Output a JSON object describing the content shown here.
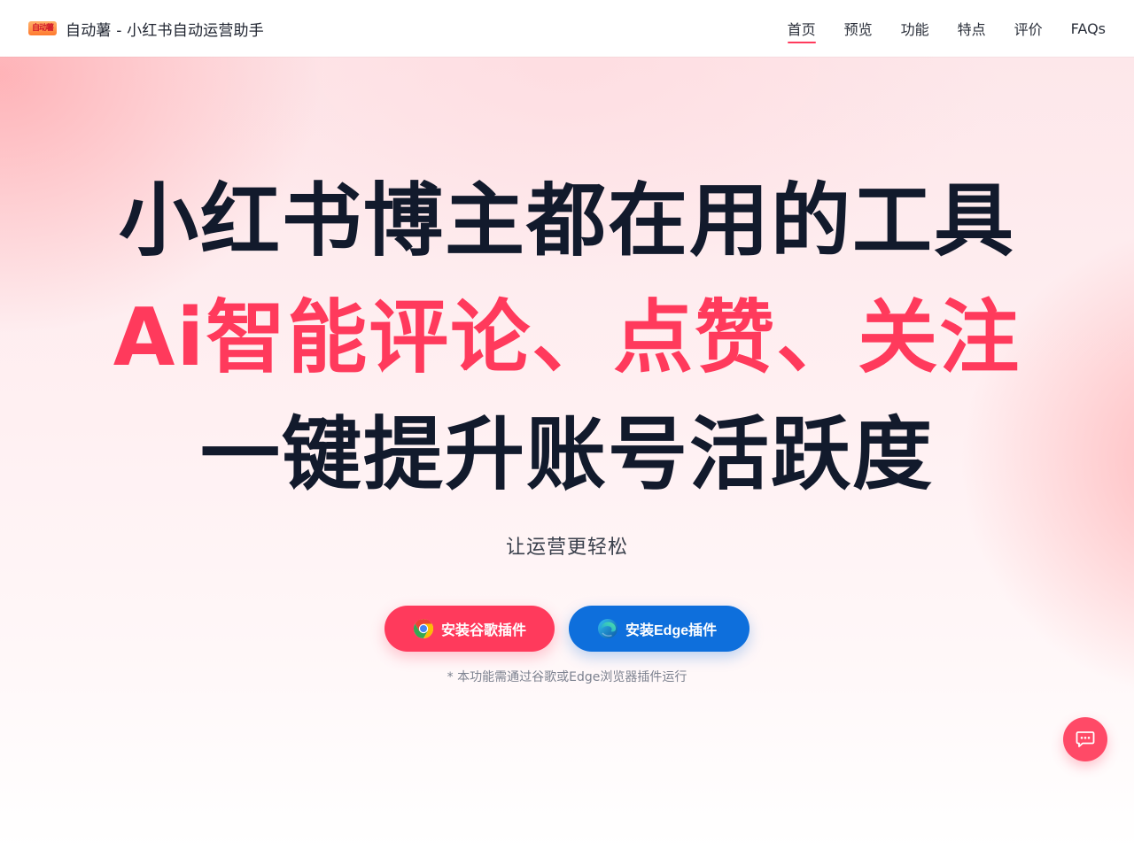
{
  "header": {
    "logo_text": "自动薯",
    "title": "自动薯 - 小红书自动运营助手",
    "nav": [
      {
        "label": "首页",
        "active": true
      },
      {
        "label": "预览",
        "active": false
      },
      {
        "label": "功能",
        "active": false
      },
      {
        "label": "特点",
        "active": false
      },
      {
        "label": "评价",
        "active": false
      },
      {
        "label": "FAQs",
        "active": false
      }
    ]
  },
  "hero": {
    "line1": "小红书博主都在用的工具",
    "line2": "Ai智能评论、点赞、关注",
    "line3": "一键提升账号活跃度",
    "subtitle": "让运营更轻松",
    "buttons": {
      "chrome_label": "安装谷歌插件",
      "edge_label": "安装Edge插件"
    },
    "note": "* 本功能需通过谷歌或Edge浏览器插件运行"
  },
  "icons": {
    "chrome": "chrome-icon",
    "edge": "edge-icon",
    "chat": "chat-bubble-icon"
  },
  "colors": {
    "accent_red": "#ff3a5c",
    "edge_blue": "#0e6fdc",
    "headline_dark": "#121a2c"
  }
}
